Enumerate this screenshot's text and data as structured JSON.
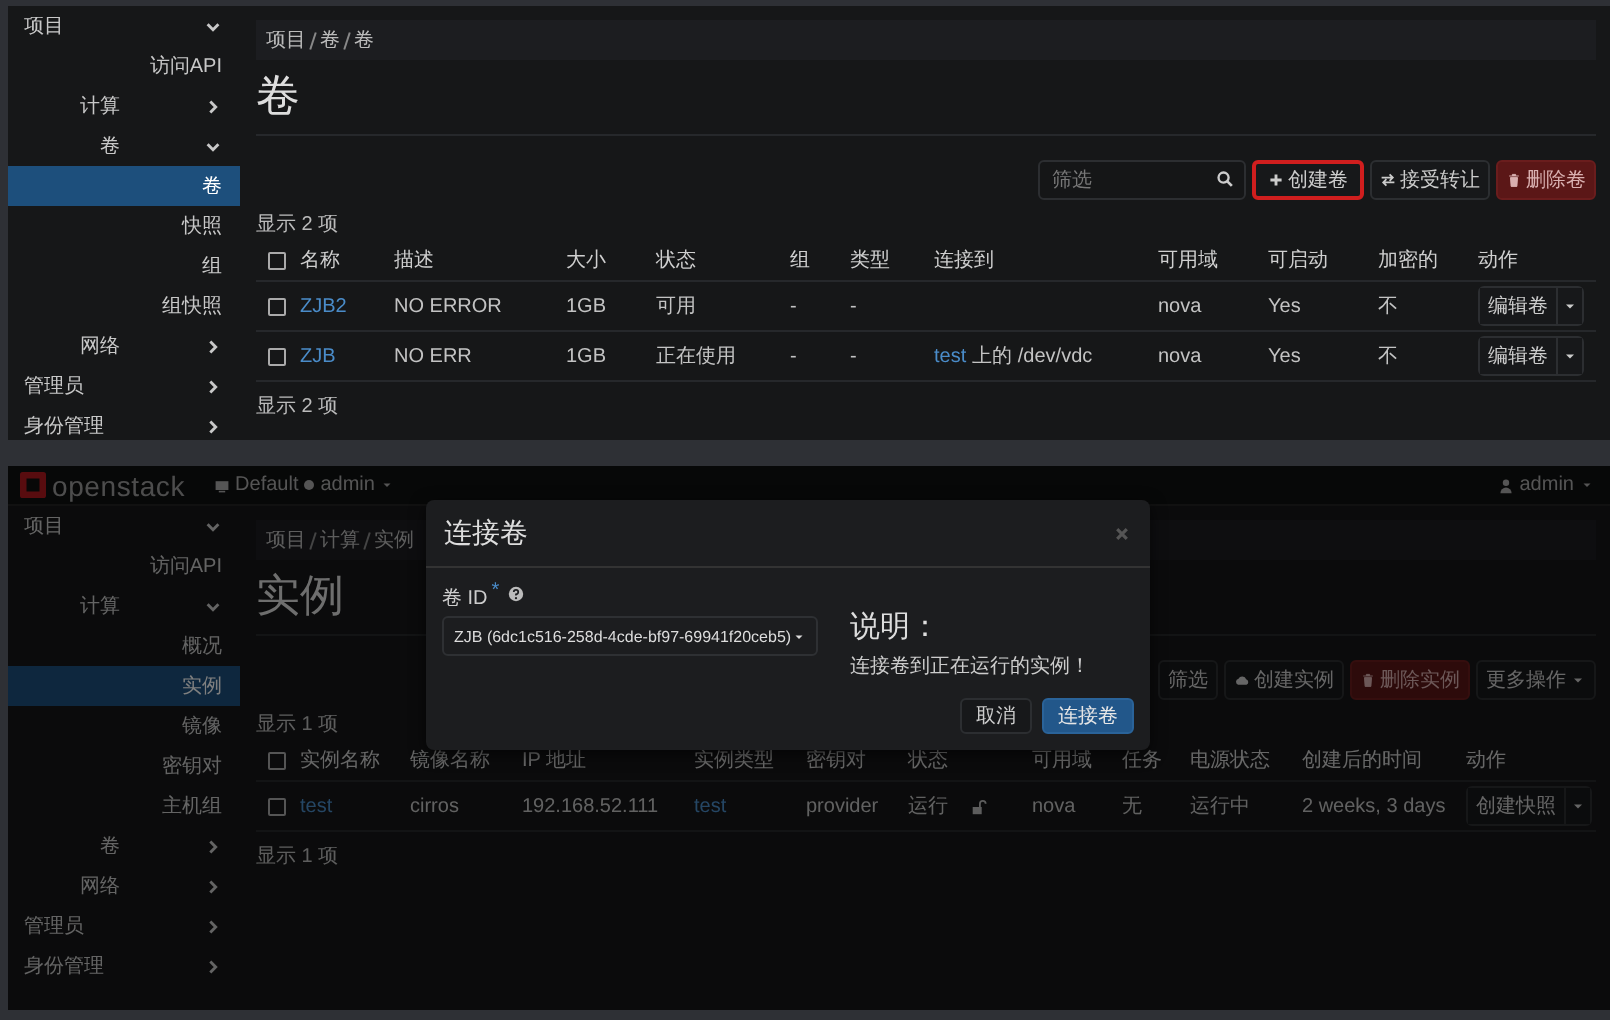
{
  "top_screen": {
    "sidebar": [
      {
        "label": "项目",
        "expanded": true,
        "selected": false,
        "children": [
          {
            "label": "访问API",
            "selected": false
          },
          {
            "label": "计算",
            "expanded": false,
            "selected": false
          },
          {
            "label": "卷",
            "expanded": true,
            "selected": false,
            "children": [
              {
                "label": "卷",
                "selected": true
              },
              {
                "label": "快照",
                "selected": false
              },
              {
                "label": "组",
                "selected": false
              },
              {
                "label": "组快照",
                "selected": false
              }
            ]
          },
          {
            "label": "网络",
            "expanded": false,
            "selected": false
          }
        ]
      },
      {
        "label": "管理员",
        "expanded": false,
        "selected": false
      },
      {
        "label": "身份管理",
        "expanded": false,
        "selected": false
      }
    ],
    "breadcrumb": [
      "项目",
      "卷",
      "卷"
    ],
    "title": "卷",
    "toolbar": {
      "filter": {
        "placeholder": "筛选"
      },
      "buttons": [
        {
          "label": "创建卷",
          "kind": "create",
          "highlighted": true
        },
        {
          "label": "接受转让",
          "kind": "transfer",
          "highlighted": false
        },
        {
          "label": "删除卷",
          "kind": "delete",
          "highlighted": false
        }
      ]
    },
    "count_top": "显示 2 项",
    "table": {
      "select_all": {
        "checked": false
      },
      "columns": [
        "名称",
        "描述",
        "大小",
        "状态",
        "组",
        "类型",
        "连接到",
        "可用域",
        "可启动",
        "加密的",
        "动作"
      ],
      "rows": [
        {
          "checked": false,
          "cells": [
            {
              "kind": "link",
              "text": "ZJB2"
            },
            "NO ERROR",
            "1GB",
            "可用",
            "-",
            "-",
            null,
            "nova",
            "Yes",
            "不",
            {
              "kind": "action",
              "label": "编辑卷"
            }
          ]
        },
        {
          "checked": false,
          "cells": [
            {
              "kind": "link",
              "text": "ZJB"
            },
            "NO ERR",
            "1GB",
            "正在使用",
            "-",
            "-",
            {
              "kind": "attach",
              "link": "test",
              "text": "上的 /dev/vdc"
            },
            "nova",
            "Yes",
            "不",
            {
              "kind": "action",
              "label": "编辑卷"
            }
          ]
        }
      ]
    },
    "count_bottom": "显示 2 项"
  },
  "bottom_screen": {
    "header": {
      "logo": "openstack",
      "project": "Default",
      "project_user": "admin",
      "user": "admin"
    },
    "sidebar": [
      {
        "label": "项目",
        "expanded": true,
        "selected": false,
        "children": [
          {
            "label": "访问API",
            "selected": false
          },
          {
            "label": "计算",
            "expanded": true,
            "selected": false,
            "children": [
              {
                "label": "概况",
                "selected": false
              },
              {
                "label": "实例",
                "selected": true
              },
              {
                "label": "镜像",
                "selected": false
              },
              {
                "label": "密钥对",
                "selected": false
              },
              {
                "label": "主机组",
                "selected": false
              }
            ]
          },
          {
            "label": "卷",
            "expanded": false,
            "selected": false
          },
          {
            "label": "网络",
            "expanded": false,
            "selected": false
          }
        ]
      },
      {
        "label": "管理员",
        "expanded": false,
        "selected": false
      },
      {
        "label": "身份管理",
        "expanded": false,
        "selected": false
      }
    ],
    "breadcrumb": [
      "项目",
      "计算",
      "实例"
    ],
    "title": "实例",
    "toolbar": {
      "buttons": [
        {
          "label": "筛选",
          "kind": "filter",
          "highlighted": false
        },
        {
          "label": "创建实例",
          "kind": "launch",
          "highlighted": false
        },
        {
          "label": "删除实例",
          "kind": "delete",
          "highlighted": false
        },
        {
          "label": "更多操作",
          "kind": "more",
          "highlighted": false
        }
      ]
    },
    "count_top": "显示 1 项",
    "table": {
      "select_all": {
        "checked": false
      },
      "columns": [
        "实例名称",
        "镜像名称",
        "IP 地址",
        "实例类型",
        "密钥对",
        "状态",
        null,
        "可用域",
        "任务",
        "电源状态",
        "创建后的时间",
        "动作"
      ],
      "rows": [
        {
          "checked": false,
          "cells": [
            {
              "kind": "link",
              "text": "test"
            },
            "cirros",
            "192.168.52.111",
            {
              "kind": "link",
              "text": "test"
            },
            "provider",
            "运行",
            {
              "kind": "lock"
            },
            "nova",
            "无",
            "运行中",
            "2 weeks, 3 days",
            {
              "kind": "action",
              "label": "创建快照"
            }
          ]
        }
      ]
    },
    "count_bottom": "显示 1 项",
    "modal": {
      "title": "连接卷",
      "field": {
        "label": "卷 ID",
        "required_mark": "*",
        "value": "ZJB (6dc1c516-258d-4cde-bf97-69941f20ceb5)"
      },
      "help": {
        "heading": "说明：",
        "text": "连接卷到正在运行的实例！"
      },
      "buttons": [
        {
          "label": "取消",
          "kind": "cancel"
        },
        {
          "label": "连接卷",
          "kind": "primary"
        }
      ]
    }
  }
}
